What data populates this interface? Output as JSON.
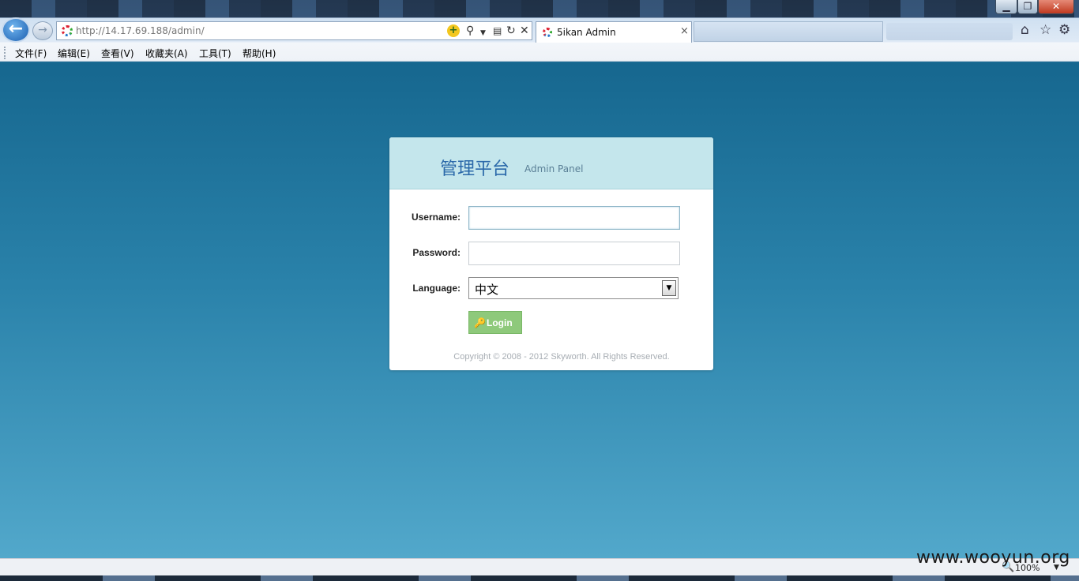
{
  "browser": {
    "window_controls": {
      "minimize": "▁",
      "maximize": "❐",
      "close": "✕"
    },
    "back_icon": "←",
    "forward_icon": "→",
    "address": {
      "url_host": "http://14.17.69.188",
      "url_path": "/admin/"
    },
    "tab": {
      "title": "5ikan Admin",
      "close": "×"
    },
    "menu": [
      "文件(F)",
      "编辑(E)",
      "查看(V)",
      "收藏夹(A)",
      "工具(T)",
      "帮助(H)"
    ],
    "tool_icons": {
      "home": "⌂",
      "favorites": "☆",
      "settings": "⚙"
    }
  },
  "login": {
    "title": "管理平台",
    "subtitle": "Admin Panel",
    "username_label": "Username:",
    "username_value": "",
    "password_label": "Password:",
    "password_value": "",
    "language_label": "Language:",
    "language_value": "中文",
    "login_button": "Login",
    "copyright": "Copyright © 2008 - 2012 Skyworth. All Rights Reserved."
  },
  "statusbar": {
    "zoom_level": "100%"
  },
  "watermark": "www.wooyun.org",
  "colors": {
    "page_top": "#16678f",
    "page_bottom": "#52a8cb",
    "header_bg": "#c4e6ec",
    "title_color": "#2a68a9",
    "login_button": "#8ec97b"
  }
}
